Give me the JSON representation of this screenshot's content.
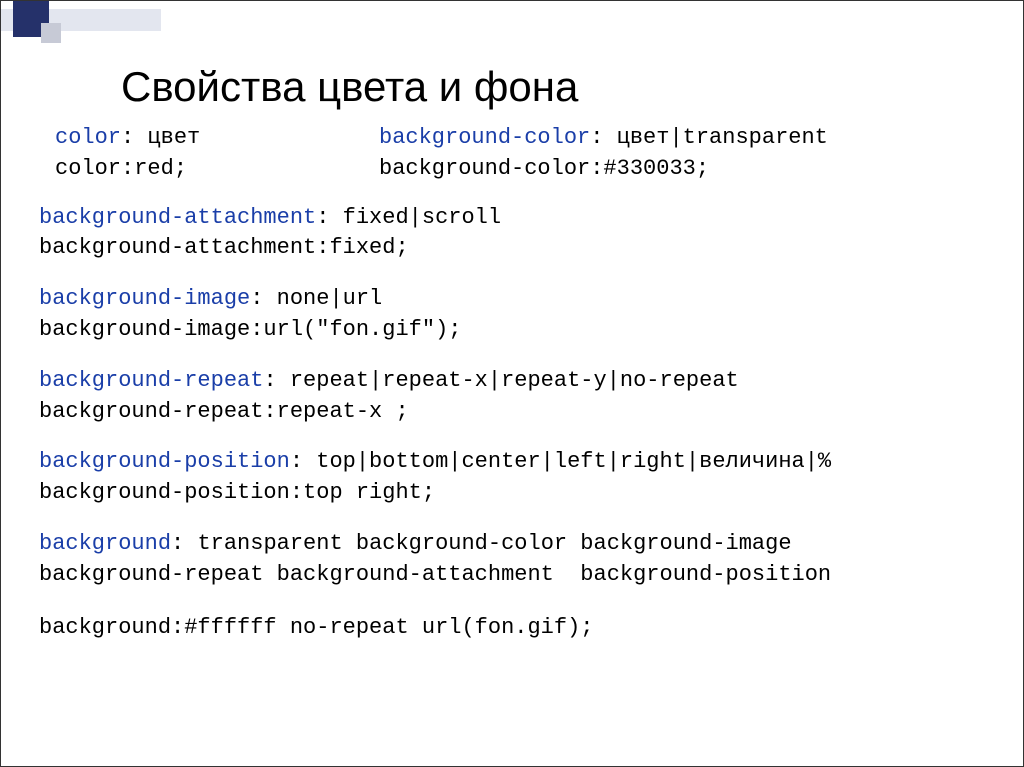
{
  "title": "Свойства цвета и фона",
  "colors": {
    "property": "#1a3ea8",
    "text": "#000000"
  },
  "topRow": {
    "left": {
      "propName": "color",
      "propSep": ": ",
      "propValues": "цвет",
      "example": "color:red;"
    },
    "right": {
      "propName": "background-color",
      "propSep": ": ",
      "propValues": "цвет|transparent",
      "example": "background-color:#330033;"
    }
  },
  "blocks": [
    {
      "propName": "background-attachment",
      "propSep": ": ",
      "propValues": "fixed|scroll",
      "example": "background-attachment:fixed;"
    },
    {
      "propName": "background-image",
      "propSep": ": ",
      "propValues": "none|url",
      "example": "background-image:url(\"fon.gif\");"
    },
    {
      "propName": "background-repeat",
      "propSep": ": ",
      "propValues": "repeat|repeat-x|repeat-y|no-repeat",
      "example": "background-repeat:repeat-x ;"
    },
    {
      "propName": "background-position",
      "propSep": ": ",
      "propValues": "top|bottom|center|left|right|величина|%",
      "example": "background-position:top right;"
    }
  ],
  "shorthand": {
    "propName": "background",
    "propSep": ": ",
    "line1Rest": "transparent background-color background-image",
    "line2": "background-repeat background-attachment  background-position",
    "example": "background:#ffffff no-repeat url(fon.gif);"
  }
}
